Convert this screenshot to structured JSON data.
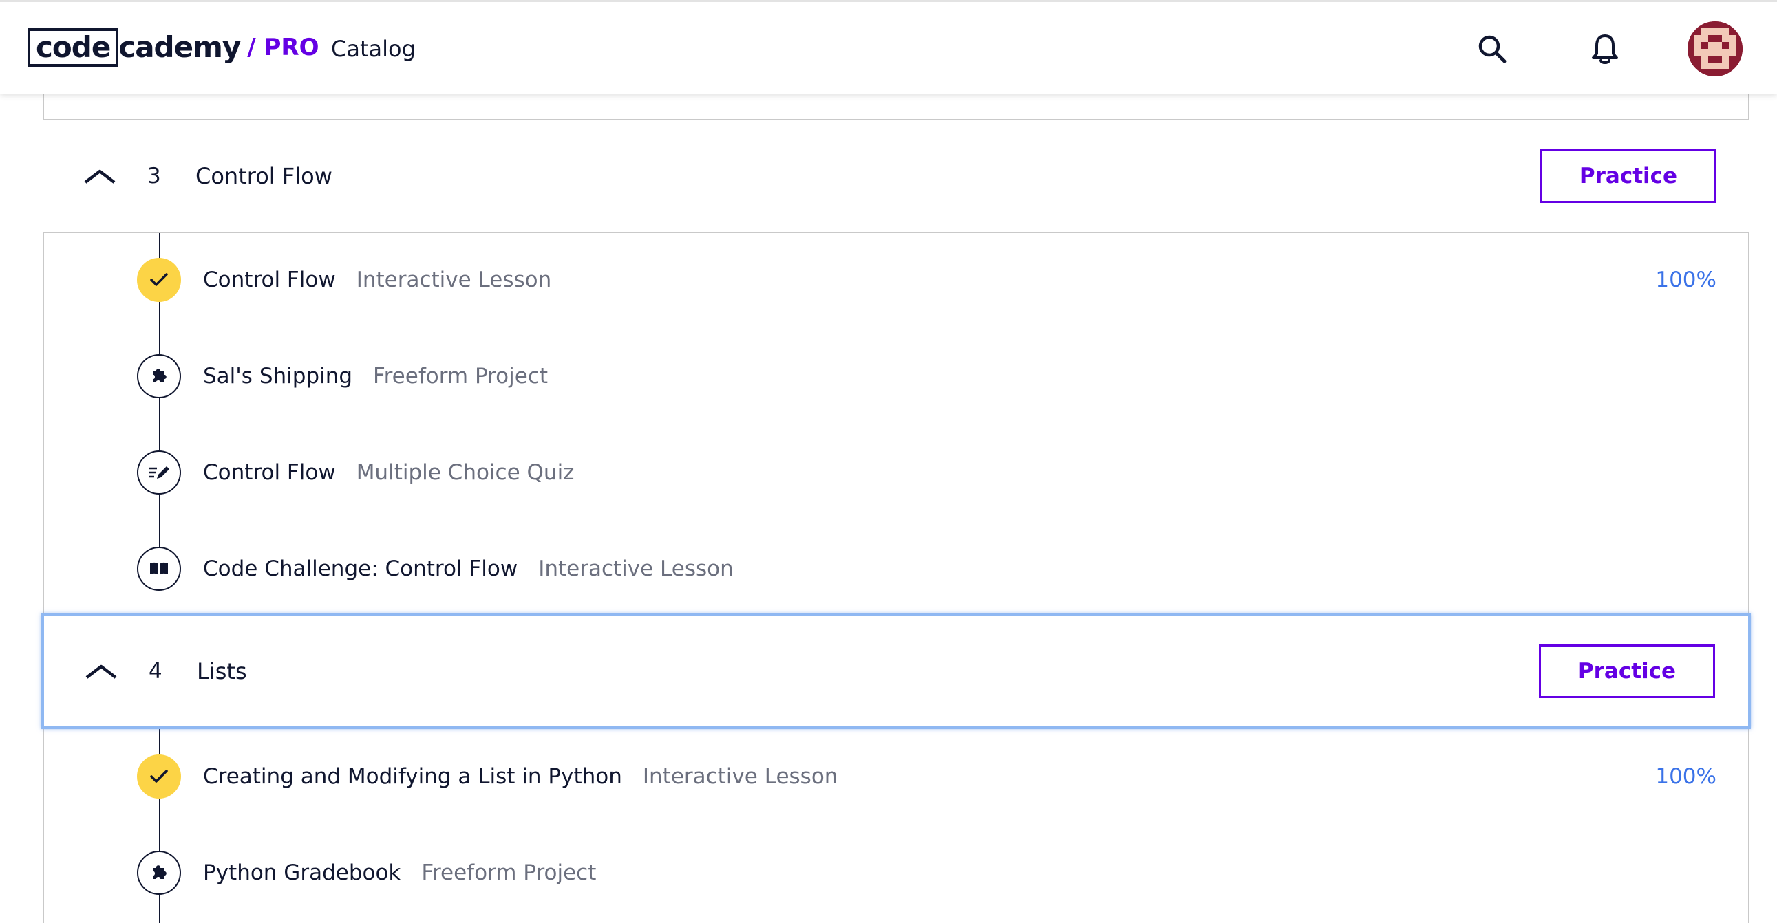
{
  "header": {
    "logo_code": "code",
    "logo_rest": "cademy",
    "logo_pro": "/ PRO",
    "catalog_label": "Catalog"
  },
  "modules": [
    {
      "number": "3",
      "title": "Control Flow",
      "practice_label": "Practice",
      "lessons": [
        {
          "title": "Control Flow",
          "type": "Interactive Lesson",
          "percent": "100%",
          "icon": "check-icon",
          "done": true
        },
        {
          "title": "Sal's Shipping",
          "type": "Freeform Project",
          "percent": "",
          "icon": "puzzle-icon",
          "done": false
        },
        {
          "title": "Control Flow",
          "type": "Multiple Choice Quiz",
          "percent": "",
          "icon": "quiz-pencil-icon",
          "done": false
        },
        {
          "title": "Code Challenge: Control Flow",
          "type": "Interactive Lesson",
          "percent": "",
          "icon": "book-icon",
          "done": false
        }
      ]
    },
    {
      "number": "4",
      "title": "Lists",
      "practice_label": "Practice",
      "lessons": [
        {
          "title": "Creating and Modifying a List in Python",
          "type": "Interactive Lesson",
          "percent": "100%",
          "icon": "check-icon",
          "done": true
        },
        {
          "title": "Python Gradebook",
          "type": "Freeform Project",
          "percent": "",
          "icon": "puzzle-icon",
          "done": false
        }
      ]
    }
  ],
  "colors": {
    "brand_purple": "#6400e4",
    "complete_yellow": "#fcd446",
    "percent_blue": "#3a72e8",
    "focus_outline": "#8fb8f2"
  }
}
